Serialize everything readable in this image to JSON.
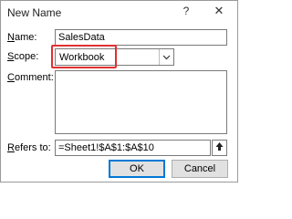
{
  "dialog": {
    "title": "New Name",
    "help_glyph": "?",
    "close_glyph": "✕"
  },
  "fields": {
    "name": {
      "label_accel": "N",
      "label_rest": "ame:",
      "value": "SalesData"
    },
    "scope": {
      "label_accel": "S",
      "label_rest": "cope:",
      "value": "Workbook",
      "highlighted": true,
      "highlight_color": "#e03131"
    },
    "comment": {
      "label_accel": "C",
      "label_rest": "omment:",
      "value": ""
    },
    "refers_to": {
      "label_accel": "R",
      "label_rest": "efers to:",
      "value": "=Sheet1!$A$1:$A$10"
    }
  },
  "buttons": {
    "ok_label": "OK",
    "cancel_label": "Cancel"
  },
  "icons": {
    "dropdown": "chevron-down-icon",
    "collapse_dialog": "collapse-dialog-icon"
  },
  "colors": {
    "accent": "#0078d7",
    "highlight": "#e03131"
  }
}
